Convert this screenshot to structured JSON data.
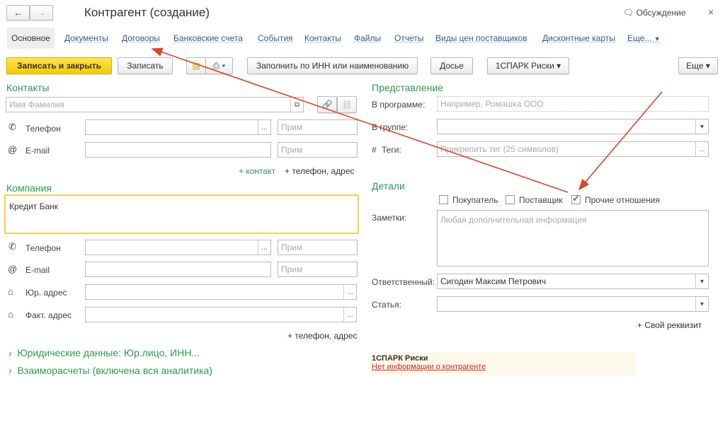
{
  "window": {
    "title": "Контрагент (создание)",
    "discussion": "Обсуждение",
    "close": "×",
    "back": "←",
    "forward": "→"
  },
  "tabs": [
    "Основное",
    "Документы",
    "Договоры",
    "Банковские счета",
    "События",
    "Контакты",
    "Файлы",
    "Отчеты",
    "Виды цен поставщиков",
    "Дисконтные карты",
    "Еще..."
  ],
  "toolbar": {
    "save_close": "Записать и закрыть",
    "save": "Записать",
    "fill_inn": "Заполнить по ИНН или наименованию",
    "dossier": "Досье",
    "spark": "1СПАРК Риски",
    "more": "Еще"
  },
  "contacts": {
    "title": "Контакты",
    "name_placeholder": "Имя Фамилия",
    "phone_label": "Телефон",
    "email_label": "E-mail",
    "note_placeholder": "Прим",
    "add_contact": "+ контакт",
    "add_phone": "+ телефон, адрес"
  },
  "company": {
    "title": "Компания",
    "name": "Кредит Банк",
    "phone_label": "Телефон",
    "email_label": "E-mail",
    "legal_label": "Юр. адрес",
    "actual_label": "Факт. адрес",
    "note_placeholder": "Прим",
    "add_phone": "+ телефон, адрес"
  },
  "sections": {
    "legal": "Юридические данные: Юр.лицо, ИНН...",
    "settlements": "Взаиморасчеты (включена вся аналитика)"
  },
  "representation": {
    "title": "Представление",
    "in_program_label": "В программе:",
    "in_program_placeholder": "Например, Ромашка ООО",
    "group_label": "В группе:",
    "tags_label": "Теги:",
    "tags_placeholder": "Прикрепить тег (25 символов)"
  },
  "details": {
    "title": "Детали",
    "buyer": "Покупатель",
    "buyer_checked": false,
    "supplier": "Поставщик",
    "supplier_checked": false,
    "other": "Прочие отношения",
    "other_checked": true,
    "notes_label": "Заметки:",
    "notes_placeholder": "Любая дополнительная информация",
    "responsible_label": "Ответственный:",
    "responsible": "Сигодин Максим Петрович",
    "article_label": "Статья:",
    "add_req": "+ Свой реквизит"
  },
  "spark": {
    "title": "1СПАРК Риски",
    "message": "Нет информации о контрагенте"
  },
  "colors": {
    "accent": "#2c9a4e",
    "annotation": "#e0442c",
    "primary_button": "#f5d000"
  }
}
